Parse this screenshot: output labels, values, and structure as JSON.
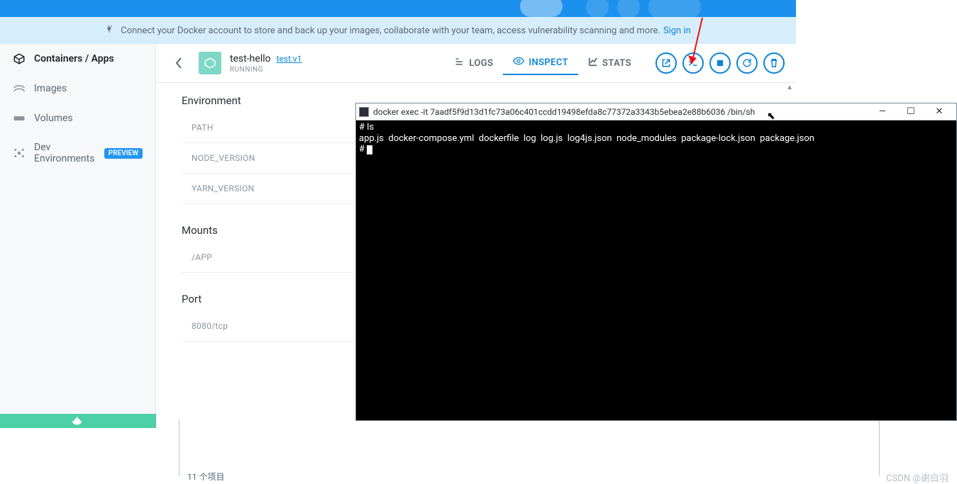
{
  "banner": {
    "text": "Connect your Docker account to store and back up your images, collaborate with your team, access vulnerability scanning and more.",
    "link_label": "Sign in"
  },
  "sidebar": {
    "items": [
      {
        "label": "Containers / Apps",
        "icon": "containers-icon",
        "active": true
      },
      {
        "label": "Images",
        "icon": "images-icon"
      },
      {
        "label": "Volumes",
        "icon": "volumes-icon"
      },
      {
        "label": "Dev Environments",
        "icon": "dev-env-icon",
        "badge": "PREVIEW"
      }
    ]
  },
  "container": {
    "name": "test-hello",
    "tag": "test:v1",
    "status": "RUNNING"
  },
  "tabs": {
    "logs": "LOGS",
    "inspect": "INSPECT",
    "stats": "STATS"
  },
  "sections": {
    "environment": "Environment",
    "env_rows": [
      "PATH",
      "NODE_VERSION",
      "YARN_VERSION"
    ],
    "mounts": "Mounts",
    "mounts_rows": [
      "/APP"
    ],
    "port": "Port",
    "port_rows": [
      "8080/tcp"
    ]
  },
  "terminal": {
    "title": "docker  exec -it 7aadf5f9d13d1fc73a06c401ccdd19498efda8c77372a3343b5ebea2e88b6036 /bin/sh",
    "lines": [
      "# ls",
      "app.js  docker-compose.yml  dockerfile  log  log.js  log4js.json  node_modules  package-lock.json  package.json",
      "# "
    ]
  },
  "footer": {
    "item_count": "11 个项目",
    "watermark": "CSDN @谢白羽"
  }
}
